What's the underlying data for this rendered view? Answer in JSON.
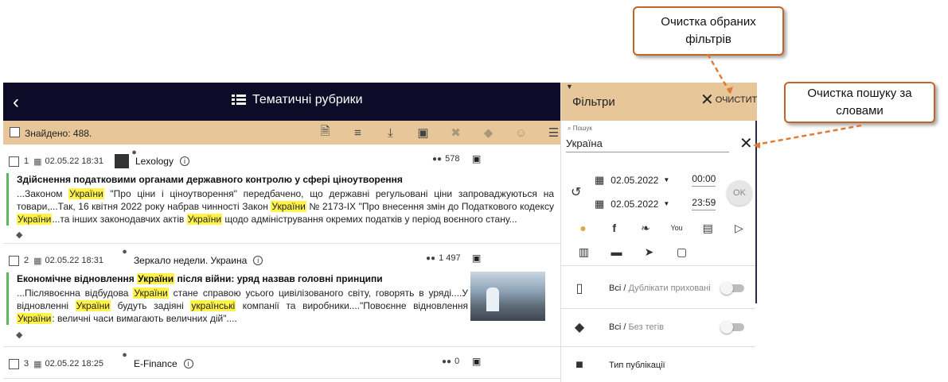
{
  "callouts": {
    "clear_filters": "Очистка обраних фільтрів",
    "clear_search": "Очистка пошуку за словами"
  },
  "topbar": {
    "back_icon": "chevron-left-icon",
    "title": "Тематичні рубрики",
    "title_icon": "list-icon"
  },
  "toolbar": {
    "found": "Знайдено: 488.",
    "icons": [
      "document-icon",
      "lines-icon",
      "download-icon",
      "save-icon",
      "delete-icon",
      "tag-icon",
      "smile-icon",
      "sort-icon"
    ]
  },
  "items": [
    {
      "num": "1",
      "date": "02.05.22 18:31",
      "source": "Lexology",
      "reach": "578",
      "headline": "Здійснення податковими органами державного контролю у сфері ціноутворення",
      "snippet": [
        {
          "t": "...Законом "
        },
        {
          "t": "України",
          "h": true
        },
        {
          "t": " \"Про ціни і ціноутворення\" передбачено, що державні регульовані ціни запроваджуються на товари,...Так, 16 квітня 2022 року набрав чинності Закон "
        },
        {
          "t": "України",
          "h": true
        },
        {
          "t": " № 2173-IX \"Про внесення змін до Податкового кодексу "
        },
        {
          "t": "України",
          "h": true
        },
        {
          "t": "...та інших законодавчих актів "
        },
        {
          "t": "України",
          "h": true
        },
        {
          "t": " щодо адміністрування окремих податків у період воєнного стану..."
        }
      ]
    },
    {
      "num": "2",
      "date": "02.05.22 18:31",
      "source": "Зеркало недели. Украина",
      "reach": "1 497",
      "headline": [
        {
          "t": "Економічне відновлення "
        },
        {
          "t": "України",
          "h": true
        },
        {
          "t": " після війни: уряд назвав головні принципи"
        }
      ],
      "snippet": [
        {
          "t": "...Післявоєнна відбудова "
        },
        {
          "t": "України",
          "h": true
        },
        {
          "t": " стане справою усього цивілізованого світу, говорять в уряді....У відновленні "
        },
        {
          "t": "України",
          "h": true
        },
        {
          "t": " будуть задіяні "
        },
        {
          "t": "українські",
          "h": true
        },
        {
          "t": " компанії та виробники....\"Повоєнне відновлення "
        },
        {
          "t": "України",
          "h": true
        },
        {
          "t": ": величні часи вимагають величних дій\"...."
        }
      ]
    },
    {
      "num": "3",
      "date": "02.05.22 18:25",
      "source": "E-Finance",
      "reach": "0"
    }
  ],
  "panel": {
    "title": "Фільтри",
    "clear_label": "очистити",
    "search_label": "Пошук",
    "search_value": "Україна",
    "date_from": "02.05.2022",
    "time_from": "00:00",
    "date_to": "02.05.2022",
    "time_to": "23:59",
    "ok_label": "OK",
    "source_icons_row1": [
      "web-icon",
      "facebook-icon",
      "twitter-icon",
      "youtube-icon",
      "newspaper-icon",
      "tv-icon"
    ],
    "source_icons_row2": [
      "radio-icon",
      "forum-icon",
      "telegram-icon",
      "instagram-icon"
    ],
    "duplicates_main": "Всі",
    "duplicates_sub": "Дублікати приховані",
    "tags_main": "Всі",
    "tags_sub": "Без тегів",
    "pub_type": "Тип публікації"
  }
}
